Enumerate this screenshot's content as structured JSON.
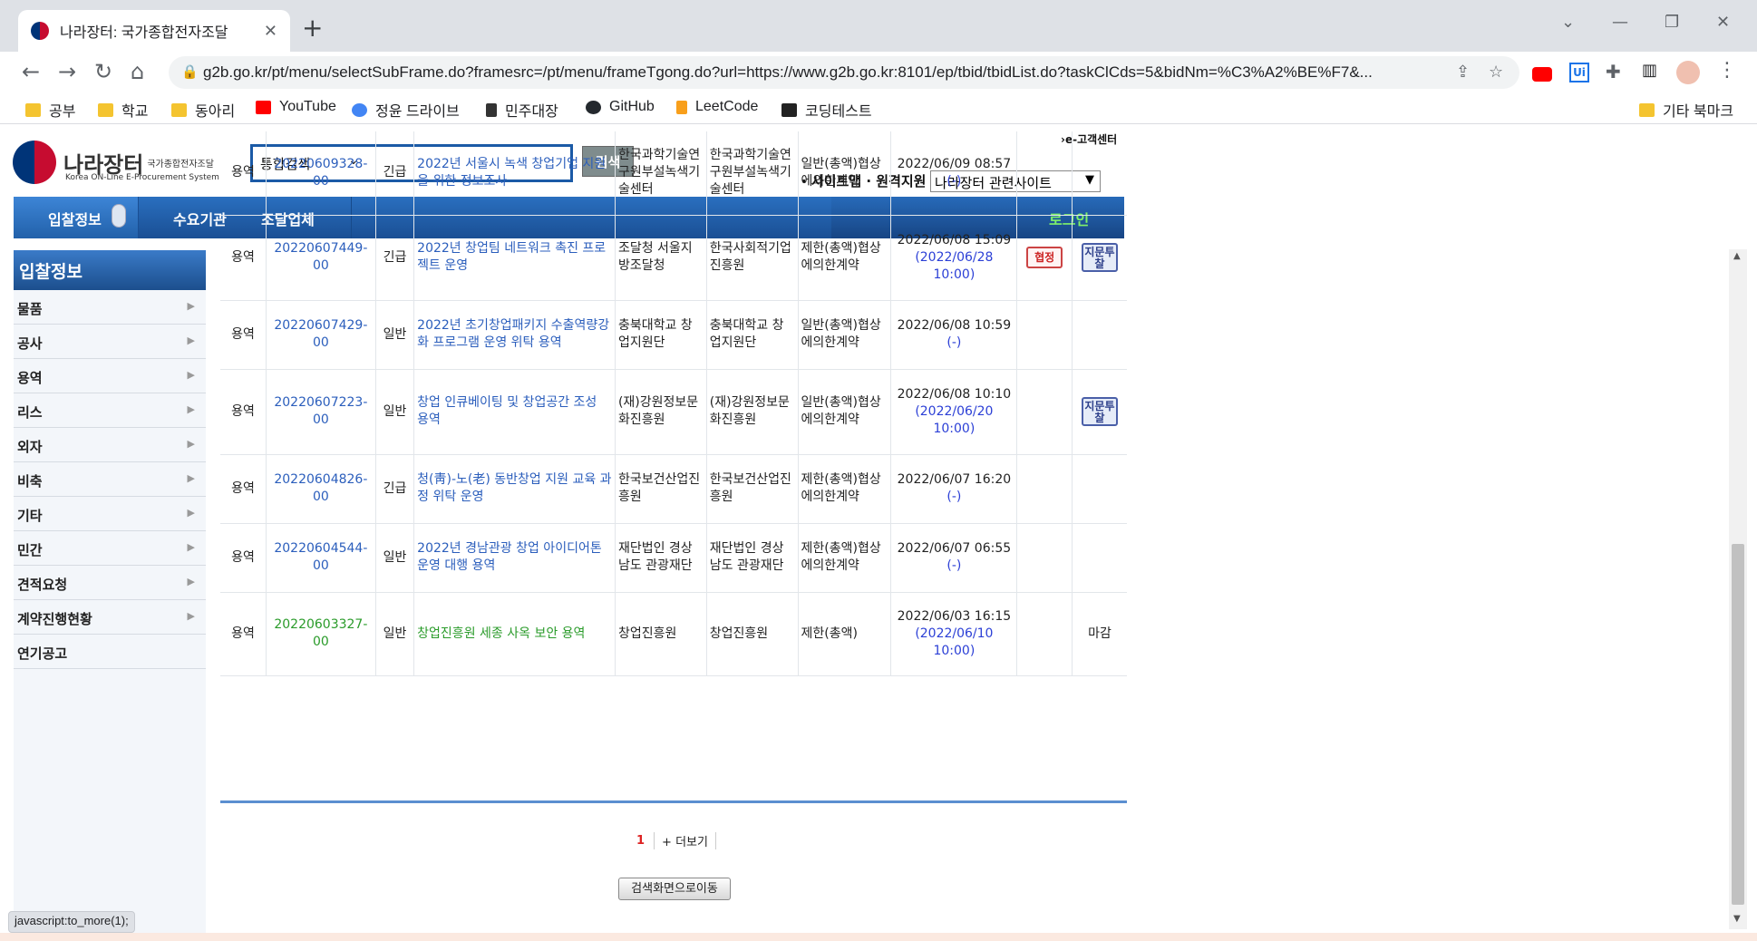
{
  "browser": {
    "tab_title": "나라장터: 국가종합전자조달",
    "url": "g2b.go.kr/pt/menu/selectSubFrame.do?framesrc=/pt/menu/frameTgong.do?url=https://www.g2b.go.kr:8101/ep/tbid/tbidList.do?taskClCds=5&bidNm=%C3%A2%BE%F7&...",
    "bookmarks": [
      "공부",
      "학교",
      "동아리",
      "YouTube",
      "정윤 드라이브",
      "민주대장",
      "GitHub",
      "LeetCode",
      "코딩테스트"
    ],
    "other_bookmarks": "기타 북마크",
    "status_text": "javascript:to_more(1);"
  },
  "header": {
    "logo_name": "나라장터",
    "logo_sub": "국가종합전자조달",
    "logo_en": "Korea ON-Line E-Procurement System",
    "search_scope": "통합검색",
    "search_button": "검색",
    "ecs_link": "›e-고객센터",
    "sitemap": "· 사이트맵 · 원격지원",
    "related_sites": "나라장터 관련사이트"
  },
  "gnb": {
    "items": [
      "입찰정보",
      "수요기관",
      "조달업체"
    ],
    "login": "로그인"
  },
  "lnb": {
    "title": "입찰정보",
    "items": [
      "물품",
      "공사",
      "용역",
      "리스",
      "외자",
      "비축",
      "기타",
      "민간",
      "견적요청",
      "계약진행현황",
      "연기공고"
    ]
  },
  "rows": [
    {
      "type": "용역",
      "no": "20220609328-00",
      "kind": "긴급",
      "title": "2022년 서울시 녹색 창업기업 지원을 위한 정보조사",
      "org1": "한국과학기술연구원부설녹색기술센터",
      "org2": "한국과학기술연구원부설녹색기술센터",
      "method": "일반(총액)협상에의한계약",
      "date": "2022/06/09 08:57",
      "deadline": "(-)",
      "badge1": "",
      "badge2": ""
    },
    {
      "type": "용역",
      "no": "20220607449-00",
      "kind": "긴급",
      "title": "2022년 창업팀 네트워크 촉진 프로젝트 운영",
      "org1": "조달청 서울지방조달청",
      "org2": "한국사회적기업진흥원",
      "method": "제한(총액)협상에의한계약",
      "date": "2022/06/08 15:09",
      "deadline": "(2022/06/28 10:00)",
      "badge1": "협정",
      "badge2": "지문투찰"
    },
    {
      "type": "용역",
      "no": "20220607429-00",
      "kind": "일반",
      "title": "2022년 초기창업패키지 수출역량강화 프로그램 운영 위탁 용역",
      "org1": "충북대학교 창업지원단",
      "org2": "충북대학교 창업지원단",
      "method": "일반(총액)협상에의한계약",
      "date": "2022/06/08 10:59",
      "deadline": "(-)",
      "badge1": "",
      "badge2": ""
    },
    {
      "type": "용역",
      "no": "20220607223-00",
      "kind": "일반",
      "title": "창업 인큐베이팅 및 창업공간 조성 용역",
      "org1": "(재)강원정보문화진흥원",
      "org2": "(재)강원정보문화진흥원",
      "method": "일반(총액)협상에의한계약",
      "date": "2022/06/08 10:10",
      "deadline": "(2022/06/20 10:00)",
      "badge1": "",
      "badge2": "지문투찰"
    },
    {
      "type": "용역",
      "no": "20220604826-00",
      "kind": "긴급",
      "title": "청(靑)-노(老) 동반창업 지원 교육 과정 위탁 운영",
      "org1": "한국보건산업진흥원",
      "org2": "한국보건산업진흥원",
      "method": "제한(총액)협상에의한계약",
      "date": "2022/06/07 16:20",
      "deadline": "(-)",
      "badge1": "",
      "badge2": ""
    },
    {
      "type": "용역",
      "no": "20220604544-00",
      "kind": "일반",
      "title": "2022년 경남관광 창업 아이디어톤 운영 대행 용역",
      "org1": "재단법인 경상남도 관광재단",
      "org2": "재단법인 경상남도 관광재단",
      "method": "제한(총액)협상에의한계약",
      "date": "2022/06/07 06:55",
      "deadline": "(-)",
      "badge1": "",
      "badge2": ""
    },
    {
      "type": "용역",
      "no": "20220603327-00",
      "kind": "일반",
      "title": "창업진흥원 세종 사옥 보안 용역",
      "org1": "창업진흥원",
      "org2": "창업진흥원",
      "method": "제한(총액)",
      "date": "2022/06/03 16:15",
      "deadline": "(2022/06/10 10:00)",
      "badge1": "",
      "badge2": "마감"
    }
  ],
  "pager": {
    "current": "1",
    "more": "+ 더보기"
  },
  "goto_search": "검색화면으로이동"
}
